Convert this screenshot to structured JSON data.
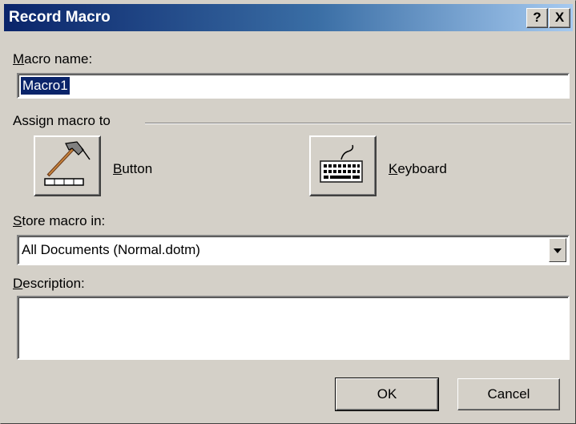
{
  "dialog": {
    "title": "Record Macro",
    "help_button": "?",
    "close_button": "X"
  },
  "macro_name": {
    "label_hotkey": "M",
    "label_rest": "acro name:",
    "value": "Macro1"
  },
  "assign": {
    "label": "Assign macro to",
    "button_hotkey": "B",
    "button_rest": "utton",
    "keyboard_hotkey": "K",
    "keyboard_rest": "eyboard"
  },
  "store": {
    "label_hotkey": "S",
    "label_rest": "tore macro in:",
    "selected": "All Documents (Normal.dotm)"
  },
  "description": {
    "label_hotkey": "D",
    "label_rest": "escription:",
    "value": ""
  },
  "buttons": {
    "ok": "OK",
    "cancel": "Cancel"
  }
}
